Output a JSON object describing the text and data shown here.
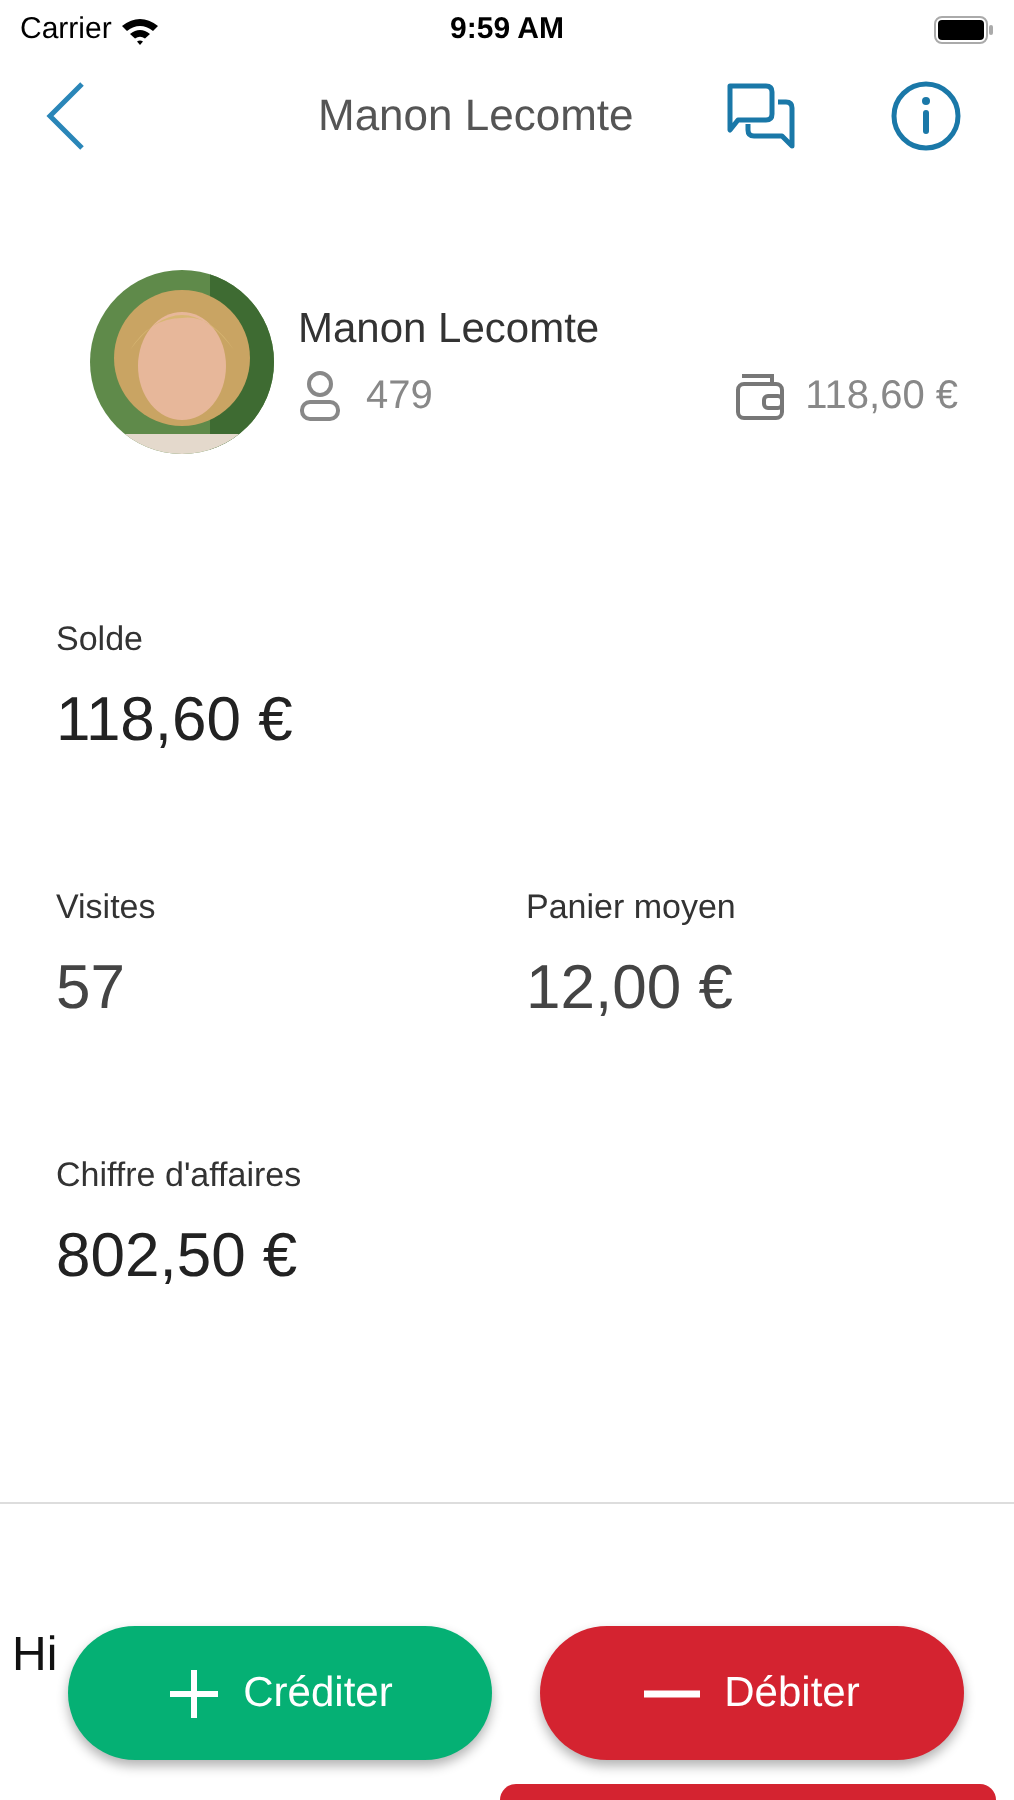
{
  "status_bar": {
    "carrier": "Carrier",
    "time": "9:59 AM"
  },
  "nav": {
    "title": "Manon Lecomte"
  },
  "profile": {
    "name": "Manon Lecomte",
    "visits_count": "479",
    "wallet_balance": "118,60 €"
  },
  "stats": [
    {
      "label": "Solde",
      "value": "118,60 €",
      "kind": "wide"
    },
    {
      "label": "Visites",
      "value": "57",
      "kind": "half"
    },
    {
      "label": "Panier moyen",
      "value": "12,00 €",
      "kind": "half"
    },
    {
      "label": "Chiffre d'affaires",
      "value": "802,50 €",
      "kind": "wide"
    }
  ],
  "history": {
    "heading": "Hi"
  },
  "actions": [
    {
      "label": "Créditer",
      "kind": "credit"
    },
    {
      "label": "Débiter",
      "kind": "debit"
    }
  ]
}
